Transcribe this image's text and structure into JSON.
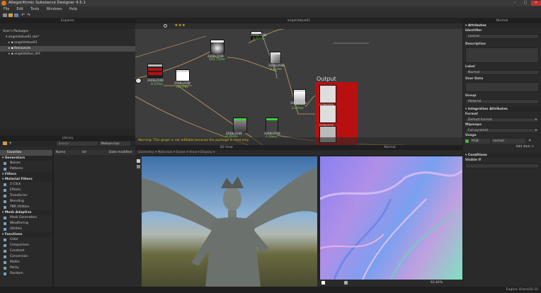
{
  "window": {
    "title": "Allegorithmic Substance Designer 4.5.1"
  },
  "menu": [
    "File",
    "Edit",
    "Tools",
    "Windows",
    "Help"
  ],
  "explorer": {
    "header": "Explorer",
    "root": "User's Packages",
    "package": "angelstatue01.sbs*",
    "items": [
      "angelstatue01",
      "Resources",
      "angelstatue_dirt"
    ]
  },
  "graph": {
    "header": "angelstatue01",
    "warning": "Warning: This graph is not editable because the package is read-only",
    "output_label": "Output",
    "nodes": [
      {
        "res": "2048x2048",
        "time": "0.62ms"
      },
      {
        "res": "2048x2048",
        "time": "101.75ms"
      },
      {
        "res": "2048x2048",
        "time": "3.61ms"
      },
      {
        "res": "2048x2048",
        "time": "0.57ms"
      },
      {
        "res": "2048x2048",
        "time": "0.17ms"
      },
      {
        "res": "2048x2048",
        "time": "2.87ms"
      },
      {
        "res": "2048x2048",
        "time": "2.41ms"
      },
      {
        "res": "2048x2048",
        "time": "0.29ms"
      }
    ],
    "output_rows": [
      "2048x2048",
      "2048x2048"
    ]
  },
  "library": {
    "header": "Library",
    "search_placeholder": "Search",
    "view_mode": "Medium Icon",
    "columns": [
      "Name",
      "Url",
      "Date modified"
    ],
    "categories": [
      {
        "label": "Favorites",
        "type": "plain",
        "selected": true
      },
      {
        "label": "Generators",
        "type": "section"
      },
      {
        "label": "Noises",
        "type": "item"
      },
      {
        "label": "Patterns",
        "type": "item"
      },
      {
        "label": "Filters",
        "type": "section"
      },
      {
        "label": "Material Filters",
        "type": "section"
      },
      {
        "label": "1-Click",
        "type": "item"
      },
      {
        "label": "Effects",
        "type": "item"
      },
      {
        "label": "Transforms",
        "type": "item"
      },
      {
        "label": "Blending",
        "type": "item"
      },
      {
        "label": "PBR Utilities",
        "type": "item"
      },
      {
        "label": "Mesh Adaptive",
        "type": "section"
      },
      {
        "label": "Mask Generators",
        "type": "item"
      },
      {
        "label": "Weathering",
        "type": "item"
      },
      {
        "label": "Utilities",
        "type": "item"
      },
      {
        "label": "Functions",
        "type": "section"
      },
      {
        "label": "Color",
        "type": "item"
      },
      {
        "label": "Comparison",
        "type": "item"
      },
      {
        "label": "Constant",
        "type": "item"
      },
      {
        "label": "Conversion",
        "type": "item"
      },
      {
        "label": "Maths",
        "type": "item"
      },
      {
        "label": "Parity",
        "type": "item"
      },
      {
        "label": "Random",
        "type": "item"
      }
    ]
  },
  "view3d": {
    "header": "3D View",
    "menu": [
      "Geometry",
      "Materials",
      "Scene",
      "View",
      "Display"
    ]
  },
  "view2d": {
    "header": "Normal",
    "zoom": "63.44%"
  },
  "attributes": {
    "header": "Normal",
    "section": "Attributes",
    "identifier_label": "Identifier",
    "identifier_value": "normal",
    "description_label": "Description",
    "label_label": "Label",
    "label_value": "Normal",
    "userdata_label": "User Data",
    "group_label": "Group",
    "group_value": "Material",
    "integration_section": "Integration Attributes",
    "format_label": "Format",
    "format_value": "Default Format",
    "mipmaps_label": "Mipmaps",
    "mipmaps_value": "Full pyramid",
    "usage_label": "Usage",
    "usage_channel": "RGB",
    "usage_value": "normal",
    "add_item": "Add item",
    "conditions_section": "Conditions",
    "visible_if_label": "Visible If"
  },
  "status": {
    "engine": "Engine: Direct3D 10"
  },
  "colors": {
    "accent": "#e0731e",
    "output_node": "#b81010",
    "time_text": "#7ddc4a",
    "warning": "#d8c020"
  }
}
